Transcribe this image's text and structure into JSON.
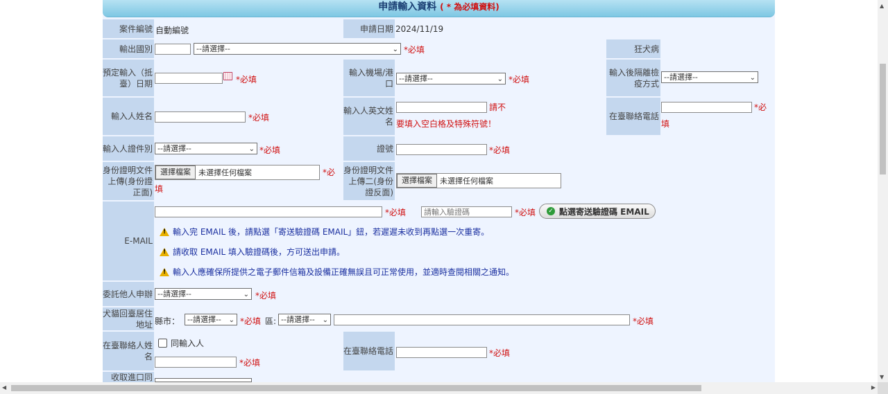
{
  "header": {
    "title": "申請輸入資料",
    "required_note": "( *  為必填資料)"
  },
  "common": {
    "required": "*必填",
    "select_placeholder": "--請選擇--",
    "file_button": "選擇檔案",
    "file_none": "未選擇任何檔案"
  },
  "row_case": {
    "label": "案件編號",
    "value": "自動編號",
    "date_label": "申請日期",
    "date_value": "2024/11/19"
  },
  "row_export": {
    "label": "輸出國別",
    "rabies_label": "狂犬病"
  },
  "row_arrival": {
    "label": "預定輸入（抵臺）日期",
    "airport_label": "輸入機場/港口",
    "quarantine_label": "輸入後隔離檢疫方式"
  },
  "row_name": {
    "label": "輸入人姓名",
    "en_label": "輸入人英文姓名",
    "en_warning": "請不要填入空白格及特殊符號！",
    "phone_label": "在臺聯絡電話"
  },
  "row_id": {
    "label": "輸入人證件別",
    "no_label": "證號"
  },
  "row_upload": {
    "front_label": "身份證明文件上傳(身份證正面)",
    "back_label": "身份證明文件上傳二(身份證反面)"
  },
  "row_email": {
    "label": "E-MAIL",
    "code_placeholder": "請輸入驗證碼",
    "send_button": "點選寄送驗證碼 EMAIL",
    "notes": [
      "輸入完 EMAIL 後，請點選「寄送驗證碼 EMAIL」鈕，若遲遲未收到再點選一次重寄。",
      "請收取 EMAIL 填入驗證碼後，方可送出申請。",
      "輸入人應確保所提供之電子郵件信箱及設備正確無誤且可正常使用，並適時查閱相關之通知。"
    ]
  },
  "row_agent": {
    "label": "委託他人申辦"
  },
  "row_address": {
    "label": "犬貓回臺居住地址",
    "city_label": "縣市：",
    "district_label": "區:"
  },
  "row_contact": {
    "label": "在臺聯絡人姓名",
    "same_label": "同輸入人",
    "phone_label": "在臺聯絡電話"
  },
  "row_port": {
    "label": "收取進口同"
  }
}
